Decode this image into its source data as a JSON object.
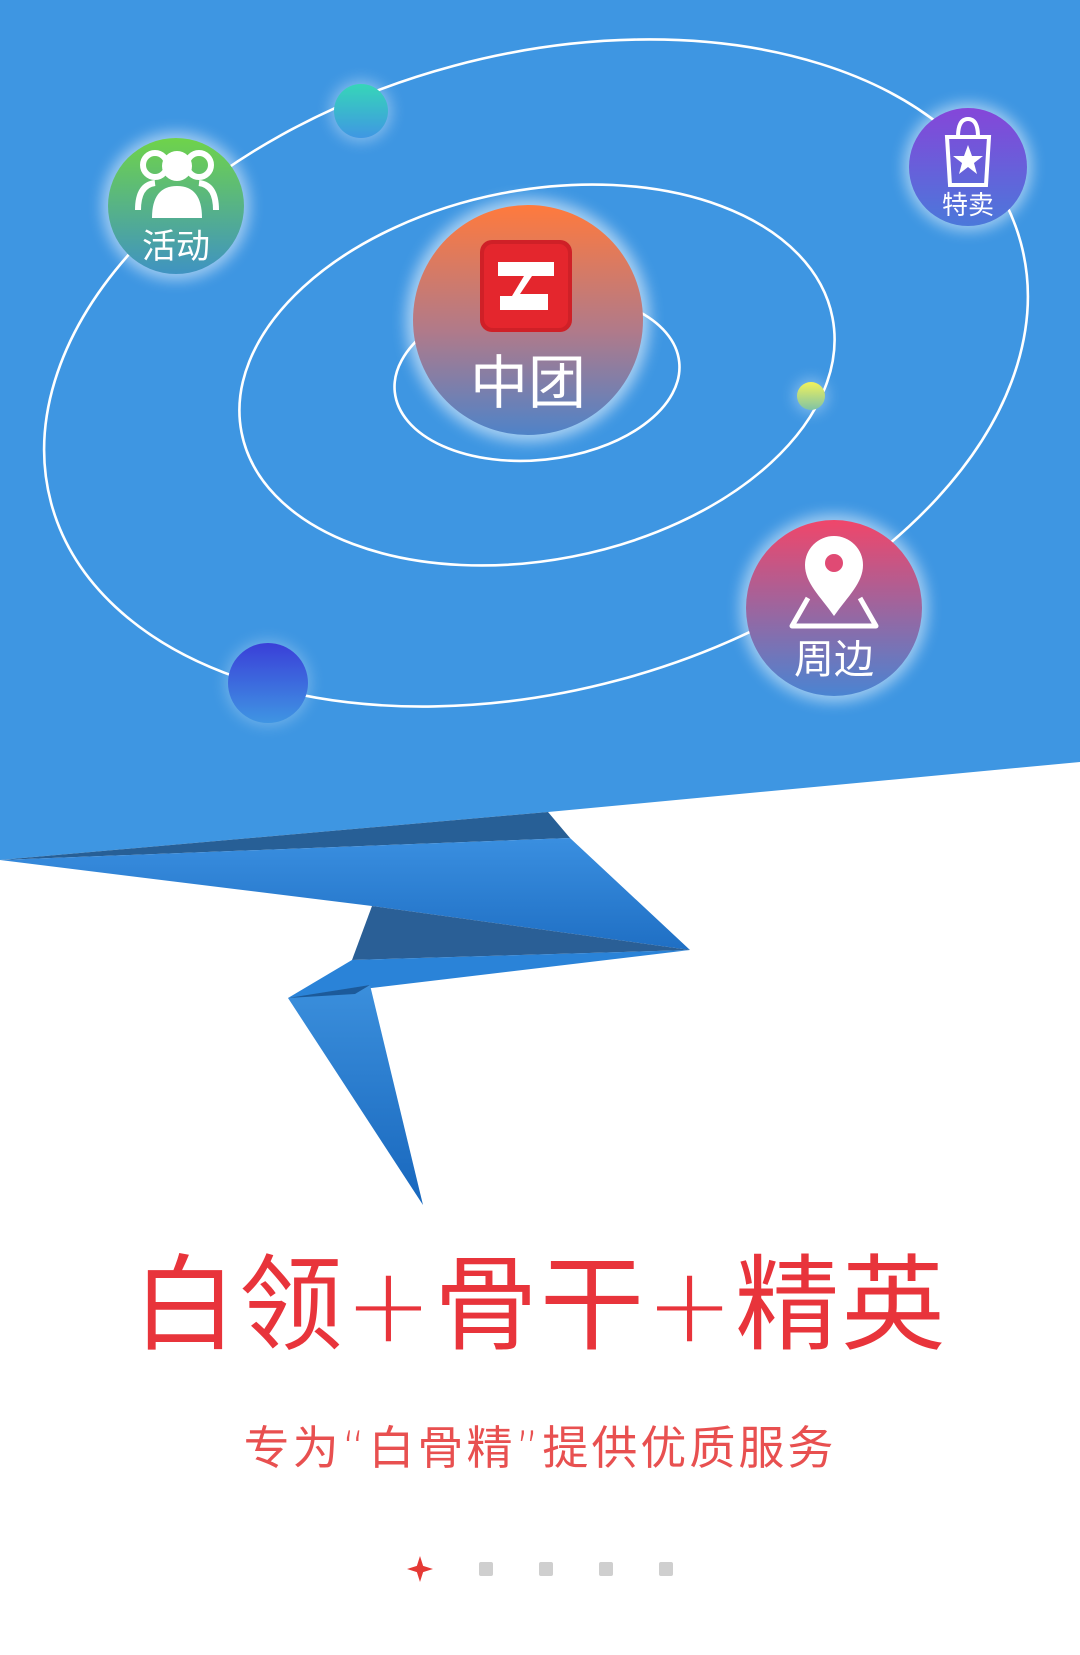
{
  "brand": {
    "name": "中团",
    "logo_icon": "zhongtuan-logo-icon"
  },
  "orbit_nodes": [
    {
      "id": "activity",
      "label": "活动",
      "icon": "people-group-icon"
    },
    {
      "id": "special_sale",
      "label": "特卖",
      "icon": "shopping-bag-star-icon"
    },
    {
      "id": "nearby",
      "label": "周边",
      "icon": "map-pin-icon"
    }
  ],
  "headline": "白领+骨干+精英",
  "subheadline": "专为“白骨精”提供优质服务",
  "pager": {
    "total": 5,
    "current": 1
  },
  "colors": {
    "sky_blue": "#3d97e3",
    "accent_red": "#e8343b",
    "dot_inactive": "#cfcfcf"
  }
}
